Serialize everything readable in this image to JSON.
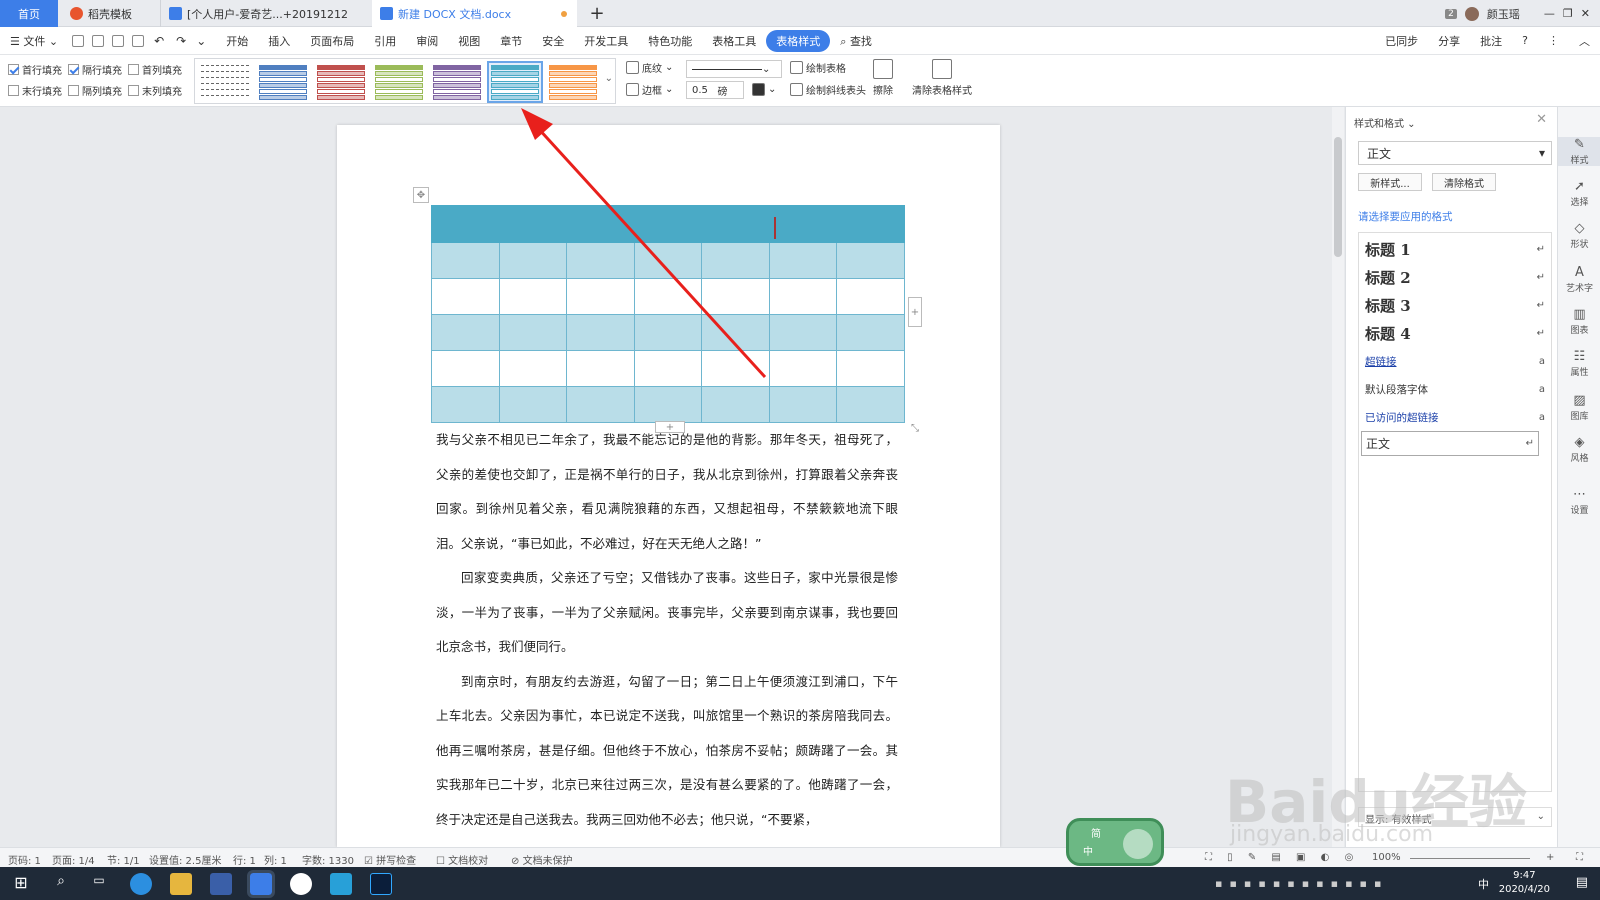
{
  "tabs": [
    {
      "label": "首页"
    },
    {
      "label": "稻壳模板"
    },
    {
      "label": "[个人用户-爱奇艺...+20191212"
    },
    {
      "label": "新建 DOCX 文档.docx"
    }
  ],
  "window": {
    "badge": "2",
    "user": "颜玉瑶"
  },
  "menu": {
    "file": "文件",
    "items": [
      "开始",
      "插入",
      "页面布局",
      "引用",
      "审阅",
      "视图",
      "章节",
      "安全",
      "开发工具",
      "特色功能",
      "表格工具",
      "表格样式"
    ],
    "search": "查找",
    "right": [
      "已同步",
      "分享",
      "批注",
      "?"
    ]
  },
  "ribbon": {
    "checks": [
      {
        "label": "首行填充",
        "on": true
      },
      {
        "label": "隔行填充",
        "on": true
      },
      {
        "label": "首列填充",
        "on": false
      },
      {
        "label": "末行填充",
        "on": false
      },
      {
        "label": "隔列填充",
        "on": false
      },
      {
        "label": "末列填充",
        "on": false
      }
    ],
    "swatch_colors": [
      "#ffffff",
      "#4f7fc0",
      "#c0504d",
      "#9bbb59",
      "#8064a2",
      "#4aaac6",
      "#f79646"
    ],
    "shading": "底纹",
    "border": "边框",
    "line_width": "0.5",
    "line_unit": "磅",
    "draw_table": "绘制表格",
    "draw_diag": "绘制斜线表头",
    "erase": "擦除",
    "clear_style": "清除表格样式"
  },
  "document": {
    "paragraphs": [
      {
        "indent": false,
        "text": "我与父亲不相见已二年余了，我最不能忘记的是他的背影。那年冬天，祖母死了，父亲的差使也交卸了，正是祸不单行的日子，我从北京到徐州，打算跟着父亲奔丧回家。到徐州见着父亲，看见满院狼藉的东西，又想起祖母，不禁簌簌地流下眼泪。父亲说，“事已如此，不必难过，好在天无绝人之路！”"
      },
      {
        "indent": true,
        "text": "回家变卖典质，父亲还了亏空；又借钱办了丧事。这些日子，家中光景很是惨淡，一半为了丧事，一半为了父亲赋闲。丧事完毕，父亲要到南京谋事，我也要回北京念书，我们便同行。"
      },
      {
        "indent": true,
        "text": "到南京时，有朋友约去游逛，勾留了一日；第二日上午便须渡江到浦口，下午上车北去。父亲因为事忙，本已说定不送我，叫旅馆里一个熟识的茶房陪我同去。他再三嘱咐茶房，甚是仔细。但他终于不放心，怕茶房不妥帖；颇踌躇了一会。其实我那年已二十岁，北京已来往过两三次，是没有甚么要紧的了。他踌躇了一会，终于决定还是自己送我去。我两三回劝他不必去；他只说，“不要紧，"
      }
    ]
  },
  "panel": {
    "title": "样式和格式",
    "current": "正文",
    "new_style": "新样式...",
    "clear_format": "清除格式",
    "apply_label": "请选择要应用的格式",
    "styles": [
      {
        "name": "标题 1",
        "mark": "↵"
      },
      {
        "name": "标题 2",
        "mark": "↵"
      },
      {
        "name": "标题 3",
        "mark": "↵"
      },
      {
        "name": "标题 4",
        "mark": "↵"
      },
      {
        "name": "超链接",
        "mark": "a"
      },
      {
        "name": "默认段落字体",
        "mark": "a"
      },
      {
        "name": "已访问的超链接",
        "mark": "a"
      },
      {
        "name": "正文",
        "mark": "↵"
      }
    ],
    "show": "显示: 有效样式"
  },
  "right_tools": [
    "样式",
    "选择",
    "形状",
    "艺术字",
    "图表",
    "属性",
    "图库",
    "风格",
    "设置"
  ],
  "status": {
    "page": "页码: 1",
    "pages": "页面: 1/4",
    "section": "节: 1/1",
    "setting": "设置值: 2.5厘米",
    "row": "行: 1",
    "col": "列: 1",
    "words": "字数: 1330",
    "spell": "拼写检查",
    "proof": "文档校对",
    "protect": "文档未保护",
    "zoom": "100%"
  },
  "taskbar": {
    "time": "9:47",
    "date": "2020/4/20",
    "lang": "中"
  },
  "ime": {
    "top": "简",
    "bottom": "中"
  },
  "watermark": {
    "text": "Baidu经验",
    "url": "jingyan.baidu.com"
  }
}
